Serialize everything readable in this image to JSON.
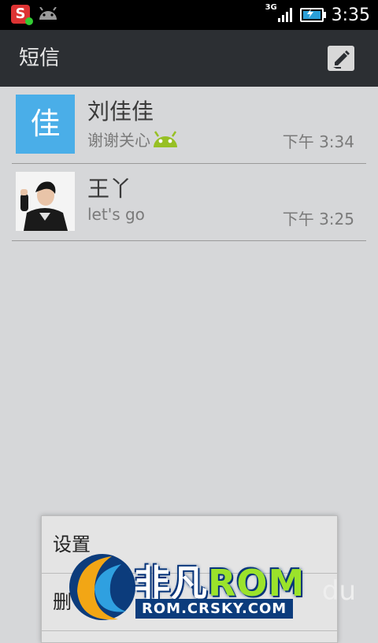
{
  "status_bar": {
    "time": "3:35",
    "network_label": "3G",
    "icons": [
      "sogou-s-icon",
      "android-icon",
      "signal-icon",
      "battery-charging-icon"
    ]
  },
  "action_bar": {
    "title": "短信",
    "compose_icon": "compose-icon"
  },
  "conversations": [
    {
      "avatar_letter": "佳",
      "name": "刘佳佳",
      "snippet": "谢谢关心",
      "snippet_icon": "android-emoji-icon",
      "time": "下午 3:34"
    },
    {
      "avatar_letter": "",
      "name": "王丫",
      "snippet": "let's go",
      "time": "下午 3:25"
    }
  ],
  "menu": {
    "items": [
      "设置",
      "删"
    ]
  },
  "watermark": {
    "brand_main": "非凡",
    "brand_rom": "ROM",
    "site": "ROM.CRSKY.COM",
    "trailing": "du"
  },
  "colors": {
    "status_bar_bg": "#000000",
    "action_bar_bg": "#2c2f33",
    "list_bg": "#d6d7d9",
    "avatar_blue": "#4aaee8",
    "android_green": "#97c024"
  }
}
